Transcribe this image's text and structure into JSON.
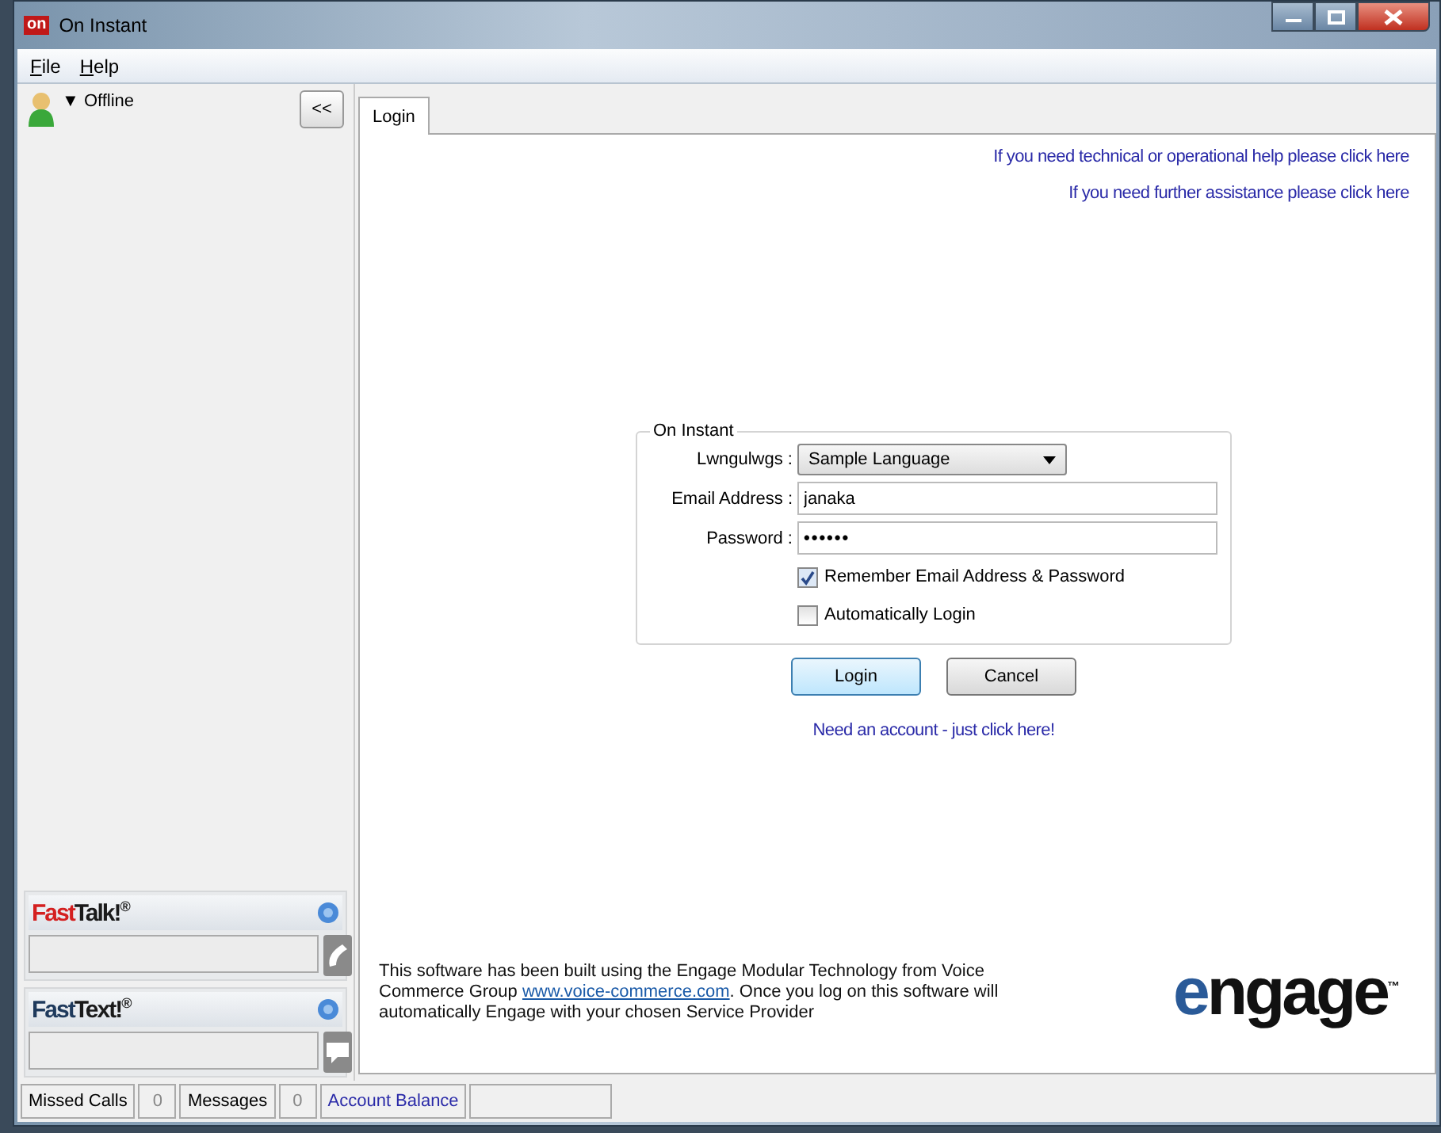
{
  "window": {
    "title": "On Instant",
    "app_icon_text": "on"
  },
  "menu": [
    {
      "accel": "F",
      "rest": "ile"
    },
    {
      "accel": "H",
      "rest": "elp"
    }
  ],
  "presence": {
    "status": "Offline",
    "arrow": "▼"
  },
  "collapse_button": "<<",
  "tabs": [
    {
      "label": "Login",
      "selected": true
    }
  ],
  "help_links": [
    "If you need technical or operational help please click here",
    "If you need further assistance please click here"
  ],
  "login_group": {
    "legend": "On Instant",
    "language": {
      "label": "Lwngulwgs :",
      "value": "Sample Language"
    },
    "email": {
      "label": "Email Address :",
      "value": "janaka"
    },
    "password": {
      "label": "Password :",
      "value": "••••••"
    },
    "options": [
      {
        "label": "Remember Email Address & Password",
        "checked": true
      },
      {
        "label": "Automatically Login",
        "checked": false
      }
    ]
  },
  "buttons": [
    {
      "label": "Login",
      "default": true
    },
    {
      "label": "Cancel",
      "default": false
    }
  ],
  "signup_link": "Need an account - just click here!",
  "about": {
    "before": "This software has been built using the Engage Modular Technology from Voice Commerce Group ",
    "link": "www.voice-commerce.com",
    "after": ". Once you log on this software will automatically Engage with your chosen Service Provider"
  },
  "logo": {
    "accent": "e",
    "rest": "ngage",
    "mark": "™"
  },
  "fast_panels": [
    {
      "kind": "talk",
      "accent": "Fast",
      "rest": "Talk!",
      "mark": "®",
      "color": "#d42020"
    },
    {
      "kind": "text",
      "accent": "Fast",
      "rest": "Text!",
      "mark": "®",
      "color": "#1f3a5c"
    }
  ],
  "status_bar": [
    {
      "kind": "label",
      "text": "Missed Calls"
    },
    {
      "kind": "count",
      "text": "0"
    },
    {
      "kind": "label",
      "text": "Messages"
    },
    {
      "kind": "count",
      "text": "0"
    },
    {
      "kind": "link",
      "text": "Account Balance"
    }
  ]
}
